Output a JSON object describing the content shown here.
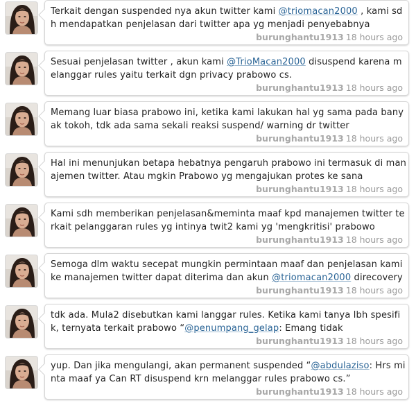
{
  "tweets": [
    {
      "parts": [
        {
          "type": "text",
          "value": "Terkait dengan suspended nya akun twitter kami "
        },
        {
          "type": "mention",
          "value": "@triomacan2000"
        },
        {
          "type": "text",
          "value": " , kami sdh mendapatkan penjelasan dari twitter apa yg menjadi penyebabnya"
        }
      ],
      "user": "burunghantu1913",
      "time": "18 hours ago"
    },
    {
      "parts": [
        {
          "type": "text",
          "value": "Sesuai penjelasan twitter , akun kami "
        },
        {
          "type": "mention",
          "value": "@TrioMacan2000"
        },
        {
          "type": "text",
          "value": " disuspend karena melanggar rules yaitu terkait dgn privacy prabowo cs."
        }
      ],
      "user": "burunghantu1913",
      "time": "18 hours ago"
    },
    {
      "parts": [
        {
          "type": "text",
          "value": "Memang luar biasa prabowo ini, ketika kami lakukan hal yg sama pada banyak tokoh, tdk ada sama sekali reaksi suspend/ warning dr twitter"
        }
      ],
      "user": "burunghantu1913",
      "time": "18 hours ago"
    },
    {
      "parts": [
        {
          "type": "text",
          "value": "Hal ini menunjukan betapa hebatnya pengaruh prabowo ini termasuk di manajemen twitter. Atau mgkin Prabowo yg mengajukan protes ke sana"
        }
      ],
      "user": "burunghantu1913",
      "time": "18 hours ago"
    },
    {
      "parts": [
        {
          "type": "text",
          "value": "Kami sdh memberikan penjelasan&meminta maaf kpd manajemen twitter terkait pelanggaran rules yg intinya twit2 kami yg 'mengkritisi' prabowo"
        }
      ],
      "user": "burunghantu1913",
      "time": "18 hours ago"
    },
    {
      "parts": [
        {
          "type": "text",
          "value": "Semoga dlm waktu secepat mungkin permintaan maaf dan penjelasan kami ke manajemen twitter dapat diterima dan akun "
        },
        {
          "type": "mention",
          "value": "@triomacan2000"
        },
        {
          "type": "text",
          "value": " direcovery"
        }
      ],
      "user": "burunghantu1913",
      "time": "18 hours ago"
    },
    {
      "parts": [
        {
          "type": "text",
          "value": "tdk ada. Mula2 disebutkan kami langgar rules. Ketika kami tanya lbh spesifik, ternyata terkait prabowo “"
        },
        {
          "type": "mention",
          "value": "@penumpang_gelap"
        },
        {
          "type": "text",
          "value": ": Emang tidak"
        }
      ],
      "user": "burunghantu1913",
      "time": "18 hours ago"
    },
    {
      "parts": [
        {
          "type": "text",
          "value": "yup. Dan jika mengulangi, akan permanent suspended “"
        },
        {
          "type": "mention",
          "value": "@abdulaziso"
        },
        {
          "type": "text",
          "value": ": Hrs minta maaf ya Can RT disuspend krn melanggar rules prabowo cs.”"
        }
      ],
      "user": "burunghantu1913",
      "time": "18 hours ago"
    }
  ],
  "avatar_icon": "user-avatar-photo",
  "colors": {
    "mention": "#2a6496",
    "meta": "#9a9a9a",
    "border": "#d6d6d6",
    "text": "#222222"
  }
}
